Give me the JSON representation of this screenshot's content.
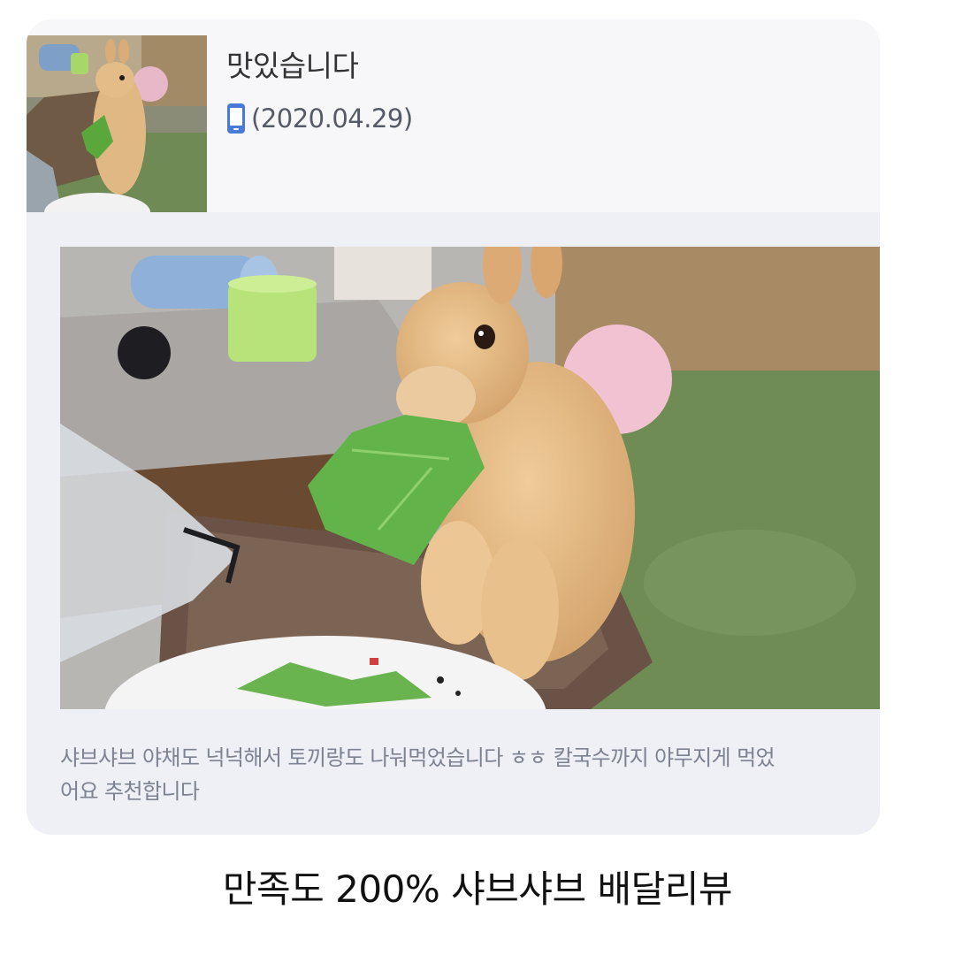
{
  "review": {
    "title": "맛있습니다",
    "date": "(2020.04.29)",
    "device_icon": "phone-icon",
    "body": "샤브샤브 야채도 넉넉해서 토끼랑도 나눠먹었습니다 ㅎㅎ 칼국수까지 야무지게 먹었\n어요 추천합니다",
    "accent_color": "#4a7ad8"
  },
  "caption": "만족도 200% 샤브샤브 배달리뷰"
}
